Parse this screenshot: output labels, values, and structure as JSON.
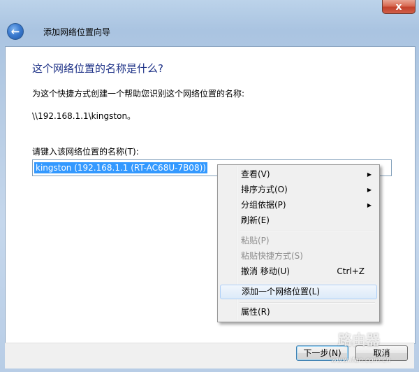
{
  "window": {
    "close_glyph": "x",
    "back_glyph": "←",
    "wizard_title": "添加网络位置向导"
  },
  "content": {
    "heading": "这个网络位置的名称是什么?",
    "description": "为这个快捷方式创建一个帮助您识别这个网络位置的名称:",
    "path": "\\\\192.168.1.1\\kingston。",
    "input_label": "请键入该网络位置的名称(T):",
    "input_value": "kingston (192.168.1.1 (RT-AC68U-7B08))"
  },
  "context_menu": {
    "items": [
      {
        "label": "查看(V)",
        "submenu": true,
        "disabled": false
      },
      {
        "label": "排序方式(O)",
        "submenu": true,
        "disabled": false
      },
      {
        "label": "分组依据(P)",
        "submenu": true,
        "disabled": false
      },
      {
        "label": "刷新(E)",
        "submenu": false,
        "disabled": false
      },
      {
        "label": "粘贴(P)",
        "submenu": false,
        "disabled": true
      },
      {
        "label": "粘贴快捷方式(S)",
        "submenu": false,
        "disabled": true
      },
      {
        "label": "撤消 移动(U)",
        "shortcut": "Ctrl+Z",
        "submenu": false,
        "disabled": false
      },
      {
        "label": "添加一个网络位置(L)",
        "submenu": false,
        "disabled": false,
        "highlighted": true
      },
      {
        "label": "属性(R)",
        "submenu": false,
        "disabled": false
      }
    ],
    "arrow_glyph": "▶"
  },
  "buttons": {
    "next": "下一步(N)",
    "cancel": "取消"
  },
  "watermark": {
    "text": "路由器",
    "url": "www.ifan.com.cn"
  }
}
